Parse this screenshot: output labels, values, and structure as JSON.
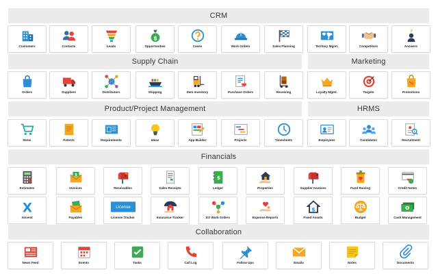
{
  "sections": {
    "crm": "CRM",
    "supply_chain": "Supply Chain",
    "marketing": "Marketing",
    "product_project": "Product/Project Management",
    "hrms": "HRMS",
    "financials": "Financials",
    "collaboration": "Collaboration"
  },
  "crm": [
    "Customers",
    "Contacts",
    "Leads",
    "Opportunities",
    "Cases",
    "Work Orders",
    "Sales Planning",
    "Territory Mgmt.",
    "Competitors",
    "Answers"
  ],
  "supply_chain": [
    "Orders",
    "Suppliers",
    "Distributors",
    "Shipping",
    "Item Inventory",
    "Purchase Orders",
    "Receiving"
  ],
  "marketing": [
    "Loyalty Mgmt.",
    "Targets",
    "Promotions"
  ],
  "product_project": [
    "Items",
    "Patents",
    "Requirements",
    "Ideas",
    "App Builder",
    "Projects",
    "Timesheets"
  ],
  "hrms": [
    "Employees",
    "Candidates",
    "Recruitment"
  ],
  "financials_row1": [
    "Estimates",
    "Invoices",
    "Receivables",
    "Sales Receipts",
    "Ledger",
    "Properties",
    "Supplier Invoices",
    "Fund Raising",
    "Credit Notes"
  ],
  "financials_row2": [
    "Xinvest",
    "Payables",
    "License Tracker",
    "Insurance Tracker",
    "Kit Work Orders",
    "Expense Reports",
    "Fixed Assets",
    "Budget",
    "Cash Management"
  ],
  "collaboration": [
    "News Feed",
    "Events",
    "Tasks",
    "Call Log",
    "Follow Ups",
    "Emails",
    "Notes",
    "Documents"
  ],
  "icon_text": {
    "license": "License",
    "xinvest": "X"
  },
  "colors": {
    "header_bg": "#ececec",
    "tile_border": "#d9d9d9",
    "blue": "#2b8fd6",
    "red": "#e2443a",
    "orange": "#f5a623",
    "green": "#3daa54"
  }
}
